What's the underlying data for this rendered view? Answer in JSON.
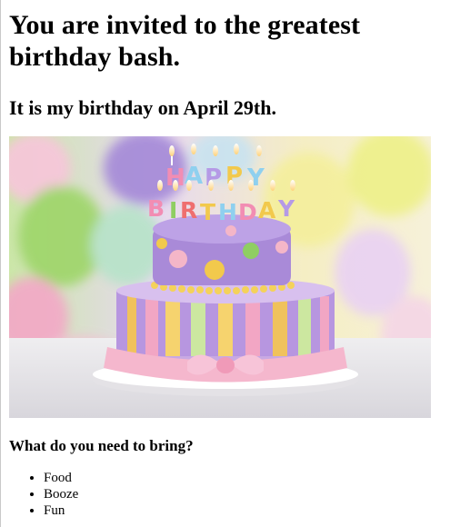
{
  "heading": "You are invited to the greatest birthday bash.",
  "subheading": "It is my birthday on April 29th.",
  "image": {
    "name": "birthday-cake-image",
    "cake_topper": [
      "HAPPY",
      "BIRTHDAY"
    ]
  },
  "bring": {
    "question": "What do you need to bring?",
    "items": [
      "Food",
      "Booze",
      "Fun"
    ]
  },
  "colors": {
    "text": "#000000",
    "background": "#ffffff",
    "cake_purple": "#a98ad8",
    "cake_yellow": "#f2c94c",
    "cake_pink": "#f4b6c8"
  }
}
